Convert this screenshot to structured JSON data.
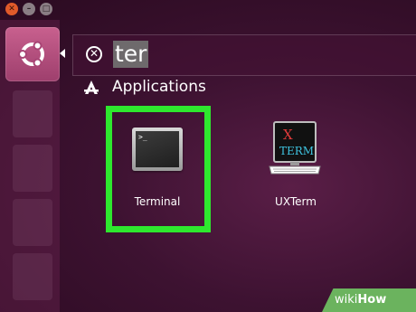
{
  "window_controls": {
    "close_glyph": "✕",
    "minimize_glyph": "–",
    "maximize_glyph": "□"
  },
  "launcher": {
    "home_icon": "ubuntu-logo-icon"
  },
  "search": {
    "clear_icon": "clear-search-icon",
    "clear_glyph": "✕",
    "query": "ter"
  },
  "category": {
    "icon": "applications-category-icon",
    "label": "Applications"
  },
  "results": [
    {
      "label": "Terminal",
      "icon": "terminal-icon",
      "prompt": ">_",
      "selected": true
    },
    {
      "label": "UXTerm",
      "icon": "uxterm-icon",
      "icon_text_top": "X",
      "icon_text_bottom": "TERM"
    }
  ],
  "watermark": {
    "prefix": "wiki",
    "suffix": "How"
  },
  "colors": {
    "highlight": "#2ee82e",
    "close_button": "#e05a2a",
    "launcher_home": "#b0507e",
    "watermark_bg": "#6bb35e"
  }
}
